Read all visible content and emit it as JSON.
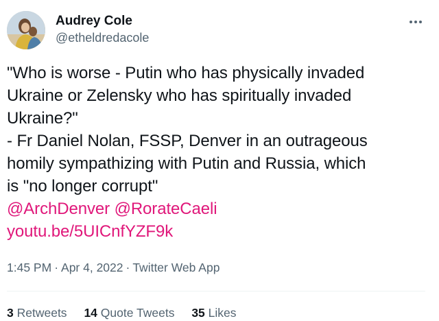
{
  "author": {
    "display_name": "Audrey Cole",
    "username": "@etheldredacole",
    "avatar_icon": "user-avatar-photo"
  },
  "more_icon": "more-horizontal-icon",
  "tweet": {
    "lines": [
      "\"Who is worse - Putin who has physically invaded",
      "Ukraine or Zelensky who has spiritually invaded",
      "Ukraine?\"",
      "- Fr Daniel Nolan, FSSP, Denver in an outrageous",
      "homily sympathizing with Putin and Russia, which",
      "is \"no longer corrupt\""
    ],
    "mentions": [
      "@ArchDenver",
      "@RorateCaeli"
    ],
    "link": "youtu.be/5UICnfYZF9k"
  },
  "meta": {
    "time": "1:45 PM",
    "date": "Apr 4, 2022",
    "source": "Twitter Web App",
    "separator": "·"
  },
  "stats": {
    "retweets_count": "3",
    "retweets_label": "Retweets",
    "quotes_count": "14",
    "quotes_label": "Quote Tweets",
    "likes_count": "35",
    "likes_label": "Likes"
  },
  "colors": {
    "link": "#e0177a",
    "secondary_text": "#536471",
    "primary_text": "#0f1419"
  }
}
